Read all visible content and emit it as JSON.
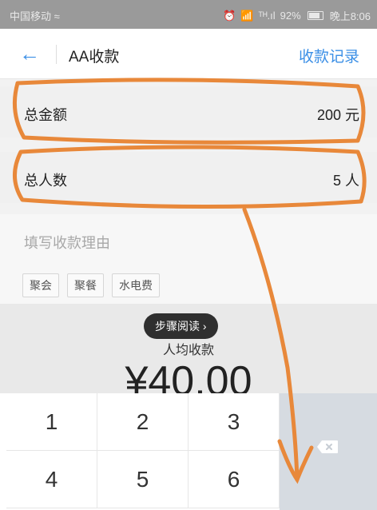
{
  "status_bar": {
    "carrier": "中国移动 ≈",
    "signal": "ᵀᴴ.ıl",
    "battery": "92%",
    "time": "晚上8:06"
  },
  "nav": {
    "title": "AA收款",
    "right_link": "收款记录",
    "back_icon": "arrow-left-icon"
  },
  "form": {
    "total_amount_label": "总金额",
    "total_amount_value": "200 元",
    "total_people_label": "总人数",
    "total_people_value": "5 人",
    "reason_placeholder": "填写收款理由",
    "chips": [
      "聚会",
      "聚餐",
      "水电费"
    ]
  },
  "summary": {
    "per_person_label": "人均收款",
    "amount": "¥40.00"
  },
  "toast": "步骤阅读",
  "keypad": {
    "keys": [
      "1",
      "2",
      "3",
      "4",
      "5",
      "6"
    ],
    "delete_icon": "backspace-icon"
  },
  "colors": {
    "accent": "#3b8fe6",
    "annotation": "#e8883a"
  }
}
